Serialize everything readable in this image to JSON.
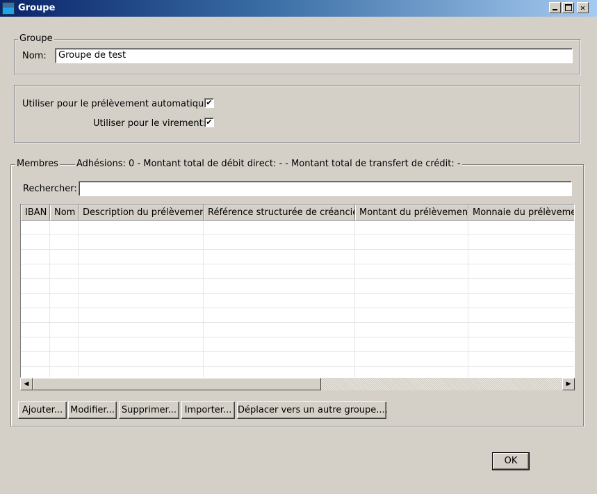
{
  "window": {
    "title": "Groupe",
    "minimize_label": "_",
    "close_label": "✕"
  },
  "group_section": {
    "legend": "Groupe",
    "name_label": "Nom:",
    "name_value": "Groupe de test"
  },
  "options": {
    "direct_debit_label": "Utiliser pour le prélèvement automatique:",
    "direct_debit_checked": true,
    "transfer_label": "Utiliser pour le virement:",
    "transfer_checked": true,
    "check_mark": "✔"
  },
  "members": {
    "legend": "Membres",
    "summary": "Adhésions: 0 - Montant total de débit direct: - - Montant total de transfert de crédit: -",
    "search_label": "Rechercher:",
    "search_value": "",
    "columns": [
      "IBAN",
      "Nom",
      "Description du prélèvement",
      "Référence structurée de créancier",
      "Montant du prélèvement",
      "Monnaie du prélèvement"
    ],
    "rows": [],
    "scroll_left": "◀",
    "scroll_right": "▶"
  },
  "actions": {
    "add": "Ajouter...",
    "edit": "Modifier...",
    "delete": "Supprimer...",
    "import": "Importer...",
    "move": "Déplacer vers un autre groupe...."
  },
  "footer": {
    "ok": "OK"
  }
}
